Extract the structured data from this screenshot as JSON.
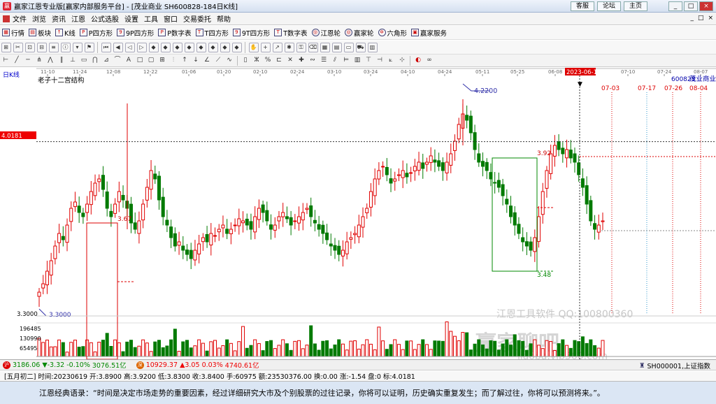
{
  "window": {
    "title": "赢家江恩专业版[赢家内部服务平台] - [茂业商业  SH600828-184日K线]",
    "links": [
      "客服",
      "论坛",
      "主页"
    ],
    "controls": [
      "_",
      "□",
      "×"
    ]
  },
  "menu": {
    "items": [
      "文件",
      "浏览",
      "资讯",
      "江恩",
      "公式选股",
      "设置",
      "工具",
      "窗口",
      "交易委托",
      "帮助"
    ],
    "doc_controls": [
      "_",
      "□",
      "×"
    ]
  },
  "toolbar": {
    "items": [
      "行情",
      "板块",
      "K线",
      "P四方形",
      "9P四方形",
      "P数字表",
      "T四方形",
      "9T四方形",
      "T数字表",
      "江恩轮",
      "赢家轮",
      "六角形",
      "赢家服务"
    ]
  },
  "chart": {
    "period_label": "日K线",
    "indicator_label": "老子十二宫结构",
    "stock_code": "600828",
    "stock_name": "茂业商业",
    "current_date_label": "2023-06-19",
    "left_price_tag": "4.0181",
    "left_axis_low": "3.3000",
    "dates_top": [
      "11-10",
      "11-24",
      "12-08",
      "12-22",
      "01-06",
      "01-20",
      "02-10",
      "02-24",
      "03-10",
      "03-24",
      "04-10",
      "04-24",
      "05-11",
      "05-25",
      "06-08",
      "07-10",
      "07-24",
      "08-07"
    ],
    "future_dates": [
      "07-03",
      "07-17",
      "07-26",
      "08-04"
    ],
    "annotations": [
      "4.2200",
      "3.3000",
      "3.67",
      "3.92",
      "3.48"
    ],
    "volume_ticks": [
      "196485",
      "130990",
      "65495"
    ],
    "watermark_1": "江恩工具软件  QQ:100800360",
    "watermark_2": "赢家聊吧",
    "watermark_3": "jiaoba.vip360.com",
    "colors": {
      "up": "#e00000",
      "down": "#007a00",
      "grid": "#dddddd",
      "cursor": "#000000"
    }
  },
  "chart_data": {
    "type": "candlestick",
    "ylim": [
      3.2,
      4.3
    ],
    "cursor_price": 4.0181,
    "high_price": 4.22,
    "low_price": 3.3
  },
  "status": {
    "sh_index": "3186.06",
    "sh_change": "▼-3.32",
    "sh_pct": "-0.10%",
    "sh_amount": "3076.51亿",
    "sz_index": "10929.37",
    "sz_change": "▲3.05",
    "sz_pct": "0.03%",
    "sz_amount": "4740.61亿",
    "right_label": "SH000001,上证指数"
  },
  "info": {
    "text": "[五月初二] 时间:20230619 开:3.8900 高:3.9200 低:3.8300 收:3.8400 手:60975 额:23530376.00 换:0.00 涨:-1.54 盘:0 标:4.0181"
  },
  "quote": {
    "text": "江恩经典语录：“时间是决定市场走势的重要因素，经过详细研究大市及个别股票的过往记录，你将可以证明，历史确实重复发生；而了解过往，你将可以预测将来。”。"
  }
}
